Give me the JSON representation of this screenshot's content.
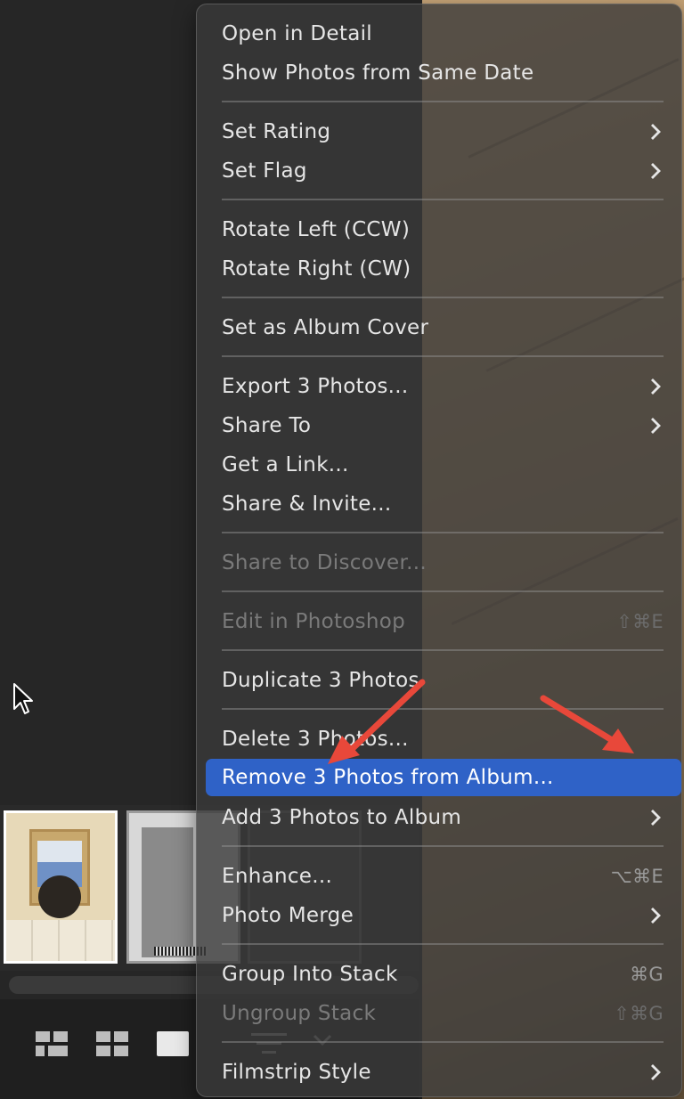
{
  "menu": {
    "items": [
      {
        "label": "Open in Detail",
        "enabled": true
      },
      {
        "label": "Show Photos from Same Date",
        "enabled": true
      },
      {
        "label": "Set Rating",
        "enabled": true,
        "submenu": true
      },
      {
        "label": "Set Flag",
        "enabled": true,
        "submenu": true
      },
      {
        "label": "Rotate Left (CCW)",
        "enabled": true
      },
      {
        "label": "Rotate Right (CW)",
        "enabled": true
      },
      {
        "label": "Set as Album Cover",
        "enabled": true
      },
      {
        "label": "Export 3 Photos...",
        "enabled": true,
        "submenu": true
      },
      {
        "label": "Share To",
        "enabled": true,
        "submenu": true
      },
      {
        "label": "Get a Link...",
        "enabled": true
      },
      {
        "label": "Share & Invite...",
        "enabled": true
      },
      {
        "label": "Share to Discover...",
        "enabled": false
      },
      {
        "label": "Edit in Photoshop",
        "enabled": false,
        "shortcut": "⇧⌘E"
      },
      {
        "label": "Duplicate 3 Photos",
        "enabled": true
      },
      {
        "label": "Delete 3 Photos...",
        "enabled": true
      },
      {
        "label": "Remove 3 Photos from Album...",
        "enabled": true,
        "highlighted": true
      },
      {
        "label": "Add 3 Photos to Album",
        "enabled": true,
        "submenu": true
      },
      {
        "label": "Enhance...",
        "enabled": true,
        "shortcut": "⌥⌘E"
      },
      {
        "label": "Photo Merge",
        "enabled": true,
        "submenu": true
      },
      {
        "label": "Group Into Stack",
        "enabled": true,
        "shortcut": "⌘G"
      },
      {
        "label": "Ungroup Stack",
        "enabled": false,
        "shortcut": "⇧⌘G"
      },
      {
        "label": "Filmstrip Style",
        "enabled": true,
        "submenu": true
      }
    ]
  },
  "colors": {
    "highlight": "#2f62c7",
    "annotation_arrow": "#e8483a"
  },
  "filmstrip": {
    "thumbnails": [
      {
        "state": "selected"
      },
      {
        "state": "selected"
      },
      {
        "state": "selected"
      }
    ]
  }
}
